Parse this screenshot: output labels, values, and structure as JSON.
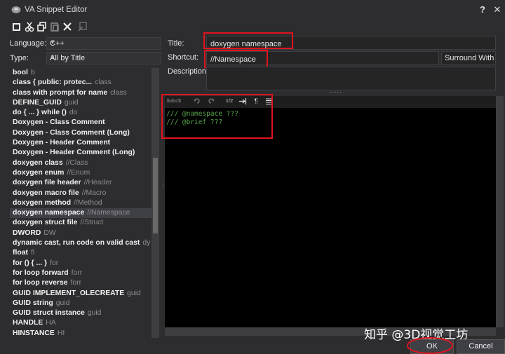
{
  "window": {
    "title": "VA Snippet Editor",
    "help_label": "?",
    "close_label": "✕"
  },
  "toolbar": {
    "icons": [
      "new-icon",
      "cut-icon",
      "copy-icon",
      "paste-icon",
      "delete-icon",
      "export-icon"
    ]
  },
  "filters": {
    "language_label": "Language:",
    "language_value": "C++",
    "type_label": "Type:",
    "type_value": "All by Title"
  },
  "form": {
    "title_label": "Title:",
    "title_value": "doxygen namespace",
    "shortcut_label": "Shortcut:",
    "shortcut_value": "//Namespace",
    "surround_label": "Surround With",
    "description_label": "Description:",
    "splitter_dots": "....."
  },
  "snippets": [
    {
      "name": "bool",
      "shortcut": "b"
    },
    {
      "name": "class  { public: protec...",
      "shortcut": "class"
    },
    {
      "name": "class with prompt for name",
      "shortcut": "class"
    },
    {
      "name": "DEFINE_GUID",
      "shortcut": "guid"
    },
    {
      "name": "do { ... } while ()",
      "shortcut": "do"
    },
    {
      "name": "Doxygen - Class Comment",
      "shortcut": ""
    },
    {
      "name": "Doxygen - Class Comment (Long)",
      "shortcut": ""
    },
    {
      "name": "Doxygen - Header Comment",
      "shortcut": ""
    },
    {
      "name": "Doxygen - Header Comment (Long)",
      "shortcut": ""
    },
    {
      "name": "doxygen class",
      "shortcut": "//Class"
    },
    {
      "name": "doxygen enum",
      "shortcut": "//Enum"
    },
    {
      "name": "doxygen file header",
      "shortcut": "//Header"
    },
    {
      "name": "doxygen macro file",
      "shortcut": "//Macro"
    },
    {
      "name": "doxygen method",
      "shortcut": "//Method"
    },
    {
      "name": "doxygen namespace",
      "shortcut": "//Namespace"
    },
    {
      "name": "doxygen struct file",
      "shortcut": "//Struct"
    },
    {
      "name": "DWORD",
      "shortcut": "DW"
    },
    {
      "name": "dynamic cast, run code on valid cast",
      "shortcut": "dy"
    },
    {
      "name": "float",
      "shortcut": "fl"
    },
    {
      "name": "for () { ... }",
      "shortcut": "for"
    },
    {
      "name": "for loop forward",
      "shortcut": "forr"
    },
    {
      "name": "for loop reverse",
      "shortcut": "forr"
    },
    {
      "name": "GUID IMPLEMENT_OLECREATE",
      "shortcut": "guid"
    },
    {
      "name": "GUID string",
      "shortcut": "guid"
    },
    {
      "name": "GUID struct instance",
      "shortcut": "guid"
    },
    {
      "name": "HANDLE",
      "shortcut": "HA"
    },
    {
      "name": "HINSTANCE",
      "shortcut": "HI"
    }
  ],
  "selected_index": 14,
  "editor_toolbar": {
    "abc_label": "$abc$",
    "number_label": "1/2",
    "pilcrow_label": "¶"
  },
  "editor": {
    "lines": [
      "/// @namespace ???",
      "/// @brief ???"
    ]
  },
  "buttons": {
    "ok_label": "OK",
    "cancel_label": "Cancel"
  },
  "watermark": "知乎 @3D视觉工坊",
  "colors": {
    "background": "#2d2d30",
    "editor_bg": "#000000",
    "comment": "#57a64a",
    "highlight": "#e0141e"
  }
}
